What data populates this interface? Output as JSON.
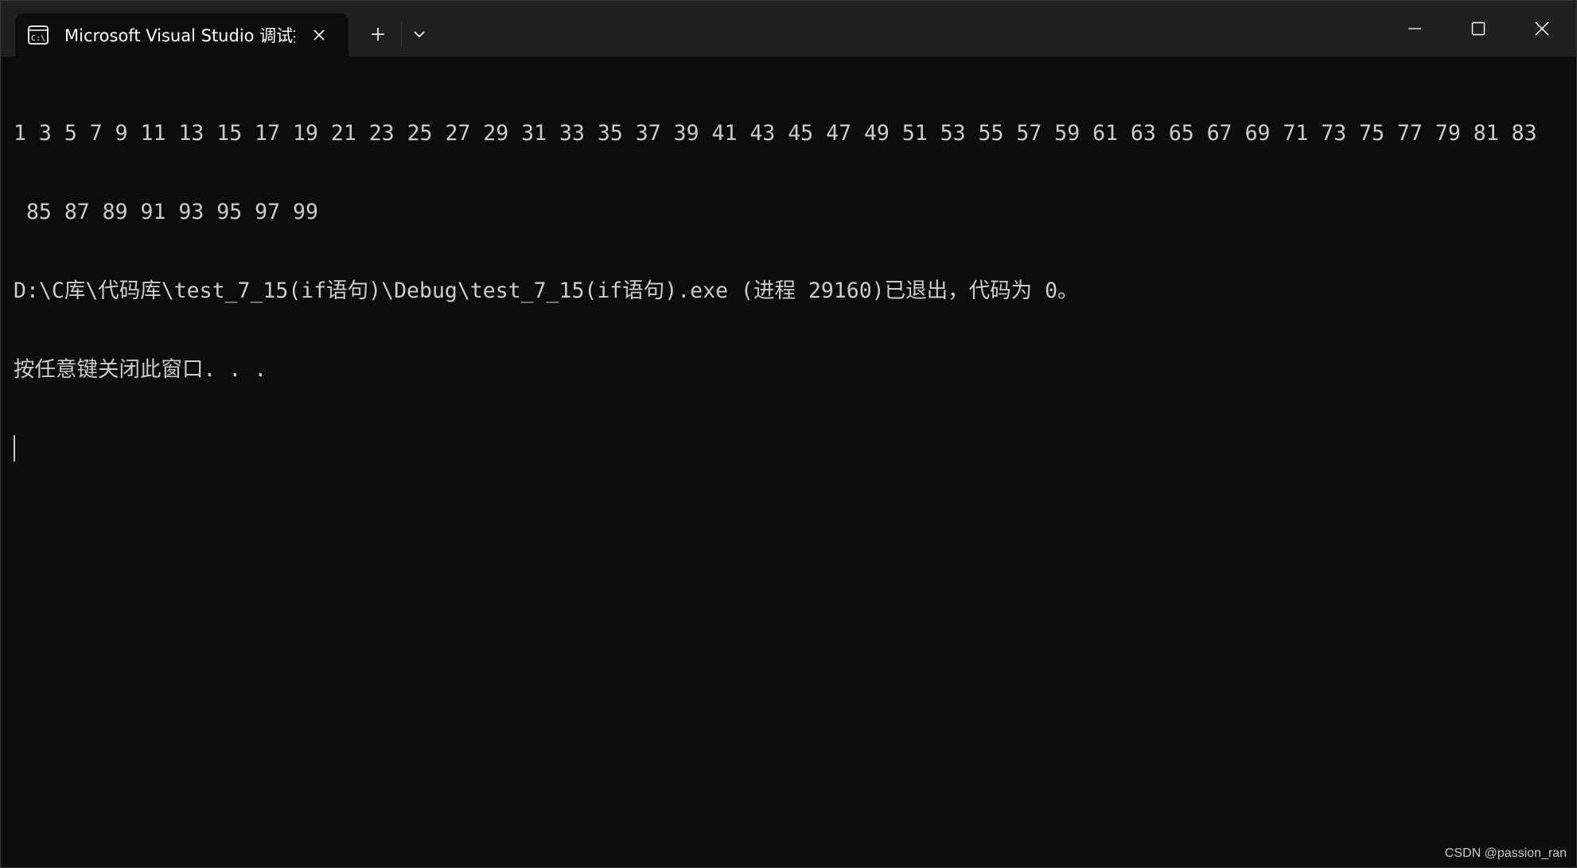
{
  "window": {
    "tab_title": "Microsoft Visual Studio 调试控制台",
    "tab_icon": "console-icon",
    "new_tab_icon": "plus-icon",
    "dropdown_icon": "chevron-down-icon",
    "minimize_icon": "minimize-icon",
    "maximize_icon": "maximize-icon",
    "close_icon": "close-icon"
  },
  "terminal": {
    "lines": [
      "1 3 5 7 9 11 13 15 17 19 21 23 25 27 29 31 33 35 37 39 41 43 45 47 49 51 53 55 57 59 61 63 65 67 69 71 73 75 77 79 81 83",
      " 85 87 89 91 93 95 97 99",
      "D:\\C库\\代码库\\test_7_15(if语句)\\Debug\\test_7_15(if语句).exe (进程 29160)已退出，代码为 0。",
      "按任意键关闭此窗口. . ."
    ]
  },
  "watermark": "CSDN @passion_ran",
  "colors": {
    "background": "#0c0c0c",
    "titlebar": "#202020",
    "text": "#cccccc"
  }
}
